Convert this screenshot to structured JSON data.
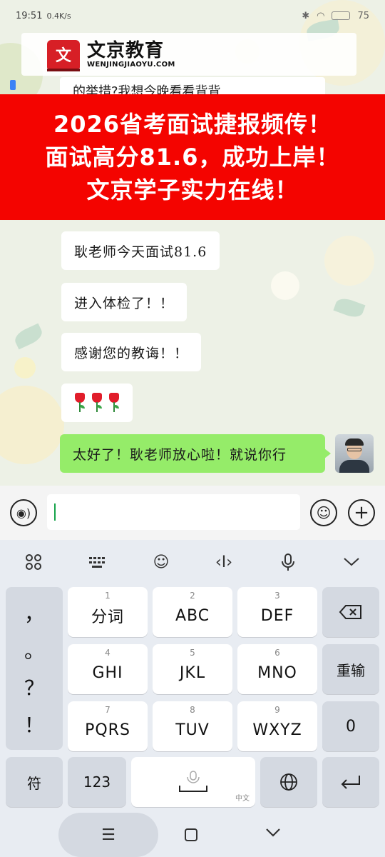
{
  "status": {
    "time": "19:51",
    "speed": "0.4K/s",
    "battery": "75"
  },
  "logo": {
    "cn": "文京教育",
    "en": "WENJINGJIAOYU.COM",
    "mark": "文"
  },
  "peek_text": "的举措?我想今晚看看背背",
  "banner": {
    "line1": "2026省考面试捷报频传！",
    "line2": "面试高分81.6，成功上岸！",
    "line3": "文京学子实力在线！"
  },
  "messages": [
    {
      "text": "耿老师今天面试81.6"
    },
    {
      "text": "进入体检了！！"
    },
    {
      "text": "感谢您的教诲！！"
    }
  ],
  "flowers_count": 3,
  "my_message": "太好了！耿老师放心啦！就说你行",
  "keyboard": {
    "punct": [
      "，",
      "。",
      "？",
      "！"
    ],
    "keys": [
      {
        "num": "1",
        "label": "分词"
      },
      {
        "num": "2",
        "label": "ABC"
      },
      {
        "num": "3",
        "label": "DEF"
      },
      {
        "num": "4",
        "label": "GHI"
      },
      {
        "num": "5",
        "label": "JKL"
      },
      {
        "num": "6",
        "label": "MNO"
      },
      {
        "num": "7",
        "label": "PQRS"
      },
      {
        "num": "8",
        "label": "TUV"
      },
      {
        "num": "9",
        "label": "WXYZ"
      }
    ],
    "reinput": "重输",
    "zero": "0",
    "symbols": "符",
    "num123": "123",
    "space_sub": "中文"
  }
}
